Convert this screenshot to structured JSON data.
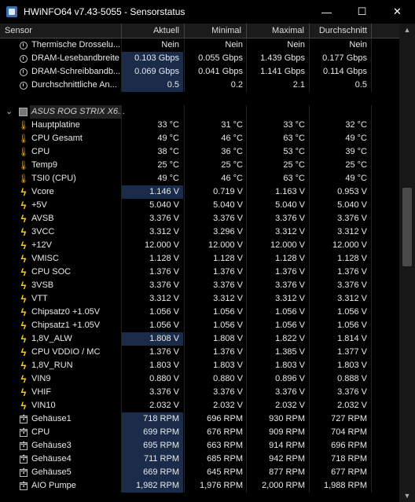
{
  "window": {
    "title": "HWiNFO64 v7.43-5055 - Sensorstatus",
    "minimize": "—",
    "maximize": "☐",
    "close": "✕"
  },
  "columns": {
    "sensor": "Sensor",
    "current": "Aktuell",
    "min": "Minimal",
    "max": "Maximal",
    "avg": "Durchschnitt"
  },
  "top_rows": [
    {
      "name": "Thermische Drosselu...",
      "icon": "clock-icon",
      "cur": "Nein",
      "min": "Nein",
      "max": "Nein",
      "avg": "Nein"
    },
    {
      "name": "DRAM-Lesebandbreite",
      "icon": "clock-icon",
      "cur": "0.103 Gbps",
      "min": "0.055 Gbps",
      "max": "1.439 Gbps",
      "avg": "0.177 Gbps"
    },
    {
      "name": "DRAM-Schreibbandb...",
      "icon": "clock-icon",
      "cur": "0.069 Gbps",
      "min": "0.041 Gbps",
      "max": "1.141 Gbps",
      "avg": "0.114 Gbps"
    },
    {
      "name": "Durchschnittliche An...",
      "icon": "clock-icon",
      "cur": "0.5",
      "min": "0.2",
      "max": "2.1",
      "avg": "0.5"
    }
  ],
  "group": {
    "name": "ASUS ROG STRIX X6...",
    "chevron": "⌄"
  },
  "rows": [
    {
      "name": "Hauptplatine",
      "icon": "thermometer-icon",
      "cur": "33 °C",
      "min": "31 °C",
      "max": "33 °C",
      "avg": "32 °C"
    },
    {
      "name": "CPU Gesamt",
      "icon": "thermometer-icon",
      "cur": "49 °C",
      "min": "46 °C",
      "max": "63 °C",
      "avg": "49 °C"
    },
    {
      "name": "CPU",
      "icon": "thermometer-icon",
      "cur": "38 °C",
      "min": "36 °C",
      "max": "53 °C",
      "avg": "39 °C"
    },
    {
      "name": "Temp9",
      "icon": "thermometer-icon",
      "cur": "25 °C",
      "min": "25 °C",
      "max": "25 °C",
      "avg": "25 °C"
    },
    {
      "name": "TSI0 (CPU)",
      "icon": "thermometer-icon",
      "cur": "49 °C",
      "min": "46 °C",
      "max": "63 °C",
      "avg": "49 °C"
    },
    {
      "name": "Vcore",
      "icon": "bolt-icon",
      "cur": "1.146 V",
      "min": "0.719 V",
      "max": "1.163 V",
      "avg": "0.953 V"
    },
    {
      "name": "+5V",
      "icon": "bolt-icon",
      "cur": "5.040 V",
      "min": "5.040 V",
      "max": "5.040 V",
      "avg": "5.040 V"
    },
    {
      "name": "AVSB",
      "icon": "bolt-icon",
      "cur": "3.376 V",
      "min": "3.376 V",
      "max": "3.376 V",
      "avg": "3.376 V"
    },
    {
      "name": "3VCC",
      "icon": "bolt-icon",
      "cur": "3.312 V",
      "min": "3.296 V",
      "max": "3.312 V",
      "avg": "3.312 V"
    },
    {
      "name": "+12V",
      "icon": "bolt-icon",
      "cur": "12.000 V",
      "min": "12.000 V",
      "max": "12.000 V",
      "avg": "12.000 V"
    },
    {
      "name": "VMISC",
      "icon": "bolt-icon",
      "cur": "1.128 V",
      "min": "1.128 V",
      "max": "1.128 V",
      "avg": "1.128 V"
    },
    {
      "name": "CPU SOC",
      "icon": "bolt-icon",
      "cur": "1.376 V",
      "min": "1.376 V",
      "max": "1.376 V",
      "avg": "1.376 V"
    },
    {
      "name": "3VSB",
      "icon": "bolt-icon",
      "cur": "3.376 V",
      "min": "3.376 V",
      "max": "3.376 V",
      "avg": "3.376 V"
    },
    {
      "name": "VTT",
      "icon": "bolt-icon",
      "cur": "3.312 V",
      "min": "3.312 V",
      "max": "3.312 V",
      "avg": "3.312 V"
    },
    {
      "name": "Chipsatz0 +1.05V",
      "icon": "bolt-icon",
      "cur": "1.056 V",
      "min": "1.056 V",
      "max": "1.056 V",
      "avg": "1.056 V"
    },
    {
      "name": "Chipsatz1 +1.05V",
      "icon": "bolt-icon",
      "cur": "1.056 V",
      "min": "1.056 V",
      "max": "1.056 V",
      "avg": "1.056 V"
    },
    {
      "name": "1,8V_ALW",
      "icon": "bolt-icon",
      "cur": "1.808 V",
      "min": "1.808 V",
      "max": "1.822 V",
      "avg": "1.814 V"
    },
    {
      "name": "CPU VDDIO / MC",
      "icon": "bolt-icon",
      "cur": "1.376 V",
      "min": "1.376 V",
      "max": "1.385 V",
      "avg": "1.377 V"
    },
    {
      "name": "1,8V_RUN",
      "icon": "bolt-icon",
      "cur": "1.803 V",
      "min": "1.803 V",
      "max": "1.803 V",
      "avg": "1.803 V"
    },
    {
      "name": "VIN9",
      "icon": "bolt-icon",
      "cur": "0.880 V",
      "min": "0.880 V",
      "max": "0.896 V",
      "avg": "0.888 V"
    },
    {
      "name": "VHIF",
      "icon": "bolt-icon",
      "cur": "3.376 V",
      "min": "3.376 V",
      "max": "3.376 V",
      "avg": "3.376 V"
    },
    {
      "name": "VIN10",
      "icon": "bolt-icon",
      "cur": "2.032 V",
      "min": "2.032 V",
      "max": "2.032 V",
      "avg": "2.032 V"
    },
    {
      "name": "Gehäuse1",
      "icon": "fan-icon",
      "cur": "718 RPM",
      "min": "696 RPM",
      "max": "930 RPM",
      "avg": "727 RPM"
    },
    {
      "name": "CPU",
      "icon": "fan-icon",
      "cur": "699 RPM",
      "min": "676 RPM",
      "max": "909 RPM",
      "avg": "704 RPM"
    },
    {
      "name": "Gehäuse3",
      "icon": "fan-icon",
      "cur": "695 RPM",
      "min": "663 RPM",
      "max": "914 RPM",
      "avg": "696 RPM"
    },
    {
      "name": "Gehäuse4",
      "icon": "fan-icon",
      "cur": "711 RPM",
      "min": "685 RPM",
      "max": "942 RPM",
      "avg": "718 RPM"
    },
    {
      "name": "Gehäuse5",
      "icon": "fan-icon",
      "cur": "669 RPM",
      "min": "645 RPM",
      "max": "877 RPM",
      "avg": "677 RPM"
    },
    {
      "name": "AIO Pumpe",
      "icon": "fan-icon",
      "cur": "1,982 RPM",
      "min": "1,976 RPM",
      "max": "2,000 RPM",
      "avg": "1,988 RPM"
    }
  ],
  "highlighted_rows": [
    "DRAM-Lesebandbreite",
    "DRAM-Schreibbandb...",
    "Durchschnittliche An...",
    "Vcore",
    "1,8V_ALW",
    "Gehäuse1",
    "CPU",
    "Gehäuse3",
    "Gehäuse4",
    "Gehäuse5",
    "AIO Pumpe"
  ],
  "colors": {
    "highlight": "#1a2c4a",
    "background": "#000000",
    "thermometer": "#e8a020",
    "bolt": "#f5d020"
  }
}
